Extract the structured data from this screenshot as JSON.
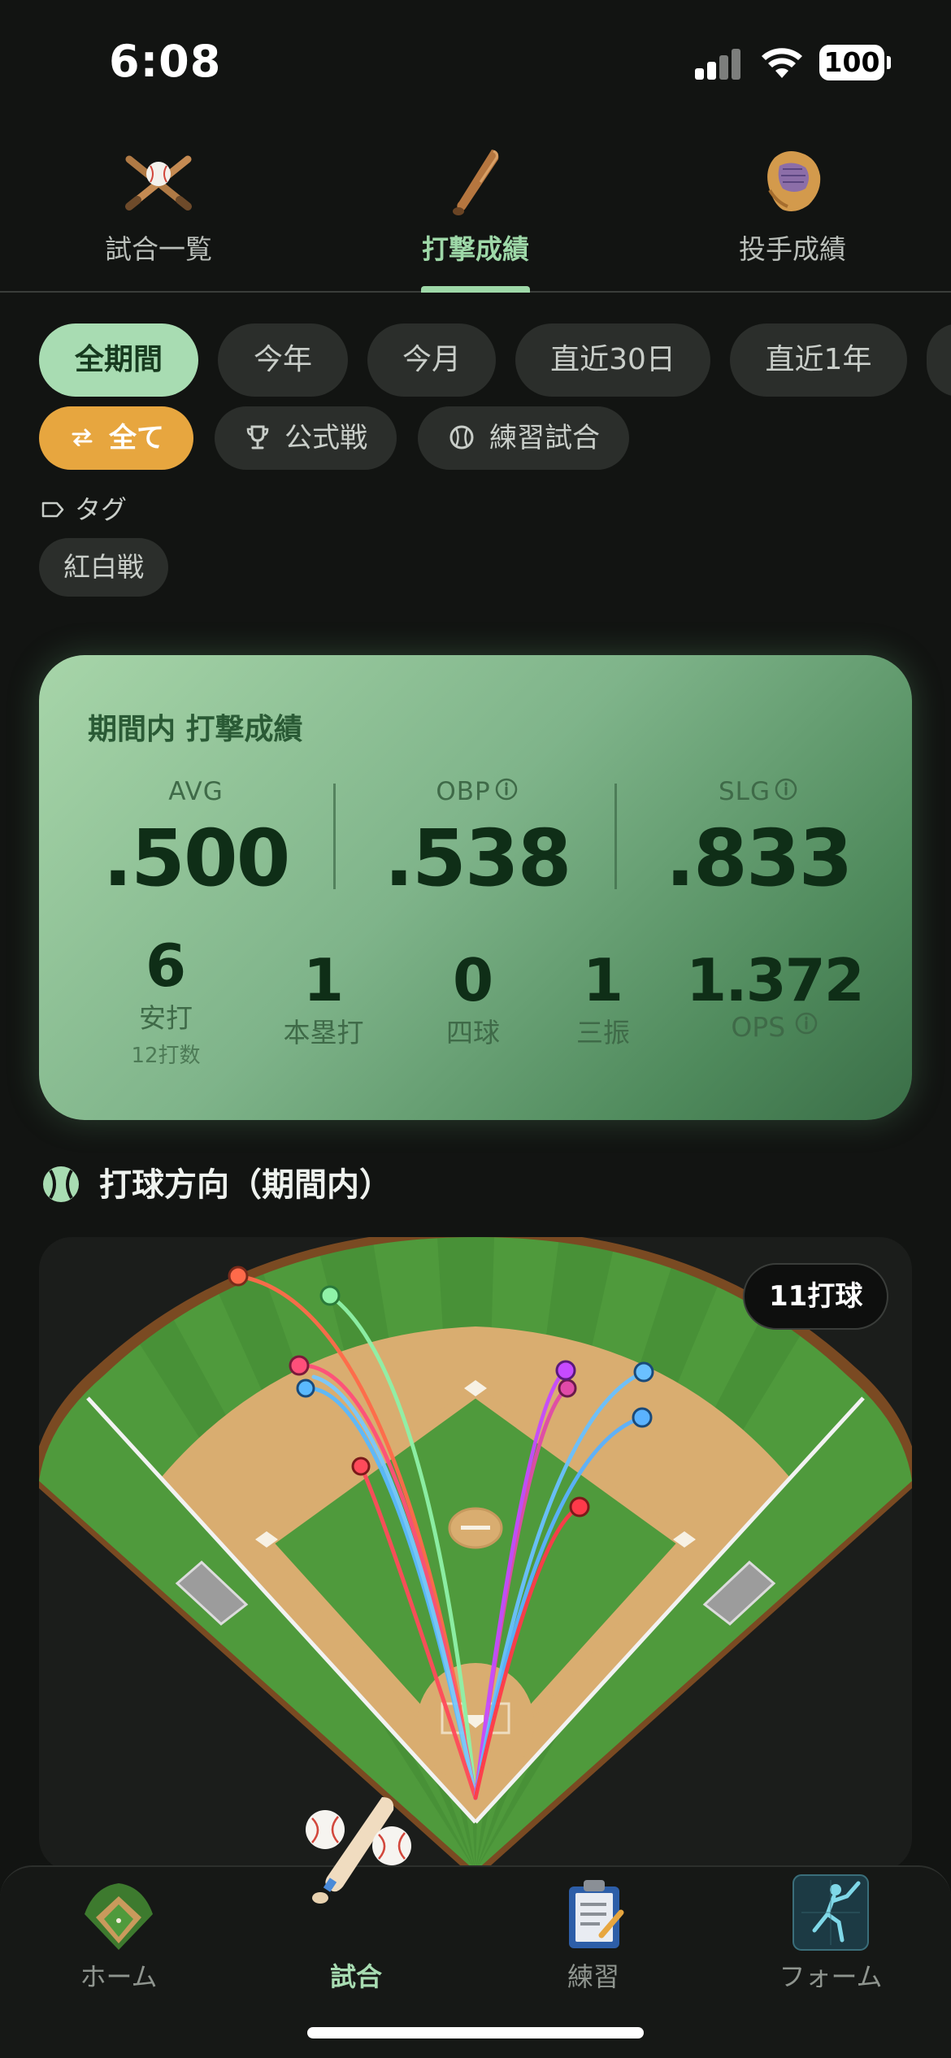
{
  "status_bar": {
    "time": "6:08",
    "battery": "100"
  },
  "top_tabs": [
    {
      "label": "試合一覧",
      "icon": "crossed-bats-icon"
    },
    {
      "label": "打撃成績",
      "icon": "bat-icon",
      "active": true
    },
    {
      "label": "投手成績",
      "icon": "glove-icon"
    }
  ],
  "period_filters": [
    "全期間",
    "今年",
    "今月",
    "直近30日",
    "直近1年"
  ],
  "period_selected": "全期間",
  "game_type_filters": [
    {
      "label": "全て",
      "icon": "swap-arrows-icon",
      "active": true
    },
    {
      "label": "公式戦",
      "icon": "trophy-icon"
    },
    {
      "label": "練習試合",
      "icon": "baseball-icon"
    }
  ],
  "tags": {
    "label": "タグ",
    "items": [
      "紅白戦"
    ]
  },
  "stats_card": {
    "title": "期間内 打撃成績",
    "avg": {
      "label": "AVG",
      "value": ".500"
    },
    "obp": {
      "label": "OBP",
      "value": ".538"
    },
    "slg": {
      "label": "SLG",
      "value": ".833"
    },
    "hits": {
      "value": "6",
      "label": "安打",
      "sub": "12打数"
    },
    "home_runs": {
      "value": "1",
      "label": "本塁打"
    },
    "walks": {
      "value": "0",
      "label": "四球"
    },
    "strikeouts": {
      "value": "1",
      "label": "三振"
    },
    "ops": {
      "value": "1.372",
      "label": "OPS"
    }
  },
  "spray_chart": {
    "title": "打球方向（期間内）",
    "badge": "11打球"
  },
  "colors": {
    "accent": "#a8dcb2",
    "orange": "#e7a63f",
    "background": "#121412"
  },
  "bottom_nav": [
    {
      "label": "ホーム",
      "icon": "field-icon"
    },
    {
      "label": "試合",
      "icon": "bat-and-balls-icon",
      "active": true
    },
    {
      "label": "練習",
      "icon": "clipboard-icon"
    },
    {
      "label": "フォーム",
      "icon": "batter-form-icon"
    }
  ]
}
